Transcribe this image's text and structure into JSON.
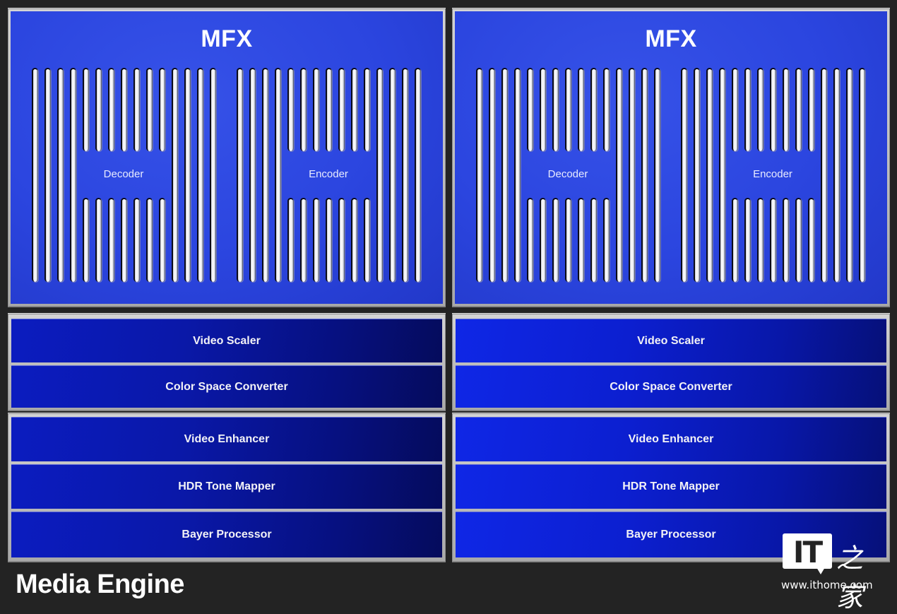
{
  "diagram": {
    "title": "Media Engine",
    "mfx_units": [
      {
        "title": "MFX",
        "blocks": [
          {
            "label": "Decoder"
          },
          {
            "label": "Encoder"
          }
        ]
      },
      {
        "title": "MFX",
        "blocks": [
          {
            "label": "Decoder"
          },
          {
            "label": "Encoder"
          }
        ]
      }
    ],
    "pipelines": [
      {
        "groups": [
          {
            "rows": [
              "Video Scaler",
              "Color Space Converter"
            ]
          },
          {
            "rows": [
              "Video Enhancer",
              "HDR Tone Mapper",
              "Bayer Processor"
            ]
          }
        ]
      },
      {
        "groups": [
          {
            "rows": [
              "Video Scaler",
              "Color Space Converter"
            ]
          },
          {
            "rows": [
              "Video Enhancer",
              "HDR Tone Mapper",
              "Bayer Processor"
            ]
          }
        ]
      }
    ],
    "slot_columns_per_block": 15,
    "short_slot_columns": 7
  },
  "watermark": {
    "logo_text": "IT",
    "logo_cn": "之家",
    "url": "www.ithome.com"
  },
  "colors": {
    "background": "#232323",
    "mfx_blue": "#2b45df",
    "pipeline_blue": "#0a18a8",
    "frame_gray": "#bdbdbd",
    "text": "#ffffff"
  }
}
